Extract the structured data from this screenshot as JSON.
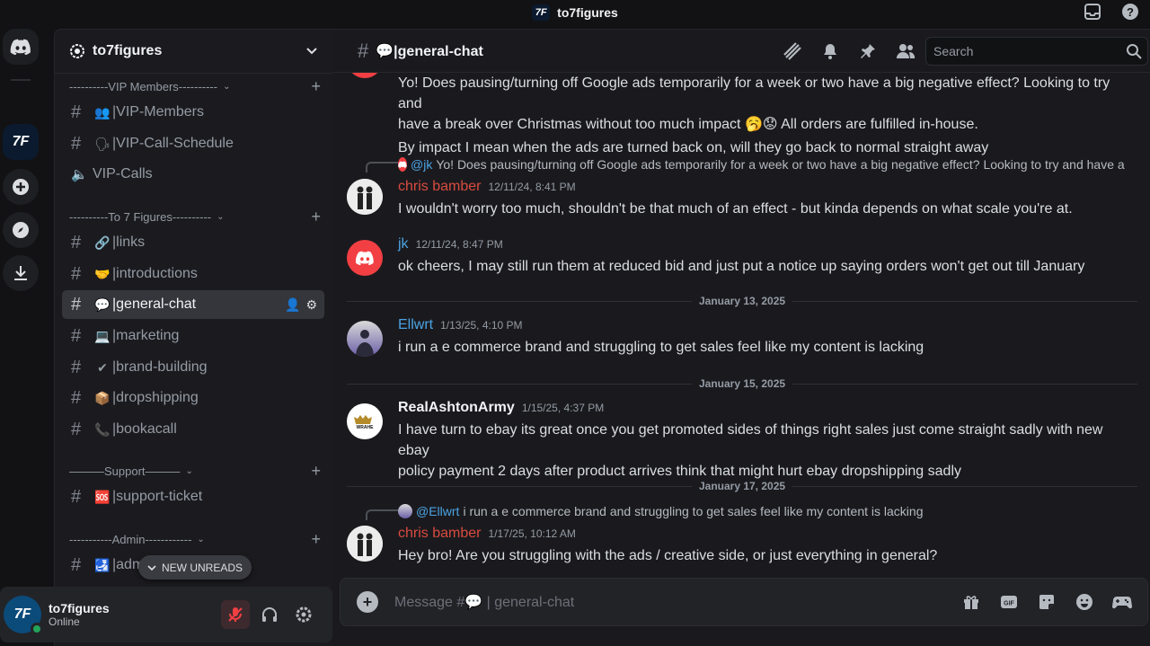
{
  "app": {
    "title": "to7figures",
    "logo_text": "7F"
  },
  "server": {
    "name": "to7figures"
  },
  "categories": [
    {
      "label": "----------VIP Members----------"
    },
    {
      "label": "----------To 7 Figures----------"
    },
    {
      "label": "———Support———"
    },
    {
      "label": "-----------Admin------------"
    }
  ],
  "channels": [
    {
      "emoji": "👥",
      "label": "|VIP-Members"
    },
    {
      "emoji": "🗣",
      "label": "|VIP-Call-Schedule"
    },
    {
      "emoji": "",
      "label": "VIP-Calls"
    },
    {
      "emoji": "🔗",
      "label": "|links"
    },
    {
      "emoji": "🤝",
      "label": "|introductions"
    },
    {
      "emoji": "💬",
      "label": "|general-chat"
    },
    {
      "emoji": "💻",
      "label": "|marketing"
    },
    {
      "emoji": "✔",
      "label": "|brand-building"
    },
    {
      "emoji": "📦",
      "label": "|dropshipping"
    },
    {
      "emoji": "📞",
      "label": "|bookacall"
    },
    {
      "emoji": "🆘",
      "label": "|support-ticket"
    },
    {
      "emoji": "🛃",
      "label": "|adm"
    }
  ],
  "new_unreads": "NEW UNREADS",
  "user": {
    "name": "to7figures",
    "status": "Online"
  },
  "header": {
    "channel": "💬|general-chat",
    "search_placeholder": "Search"
  },
  "messages": {
    "m1_line1": "Yo! Does pausing/turning off Google ads temporarily for a week or two have a big negative effect? Looking to try and",
    "m1_line2": "have a break over Christmas without too much impact",
    "m1_line2b": "All orders are fulfilled in-house.",
    "m1_line3": "By impact I mean when the ads are turned back on, will they go back to normal straight away",
    "r1_who": "@jk",
    "r1_text": "Yo! Does pausing/turning off Google ads temporarily for a week or two have a big negative effect? Looking to try and have a ...",
    "m2_author": "chris bamber",
    "m2_ts": "12/11/24, 8:41 PM",
    "m2_text": "I wouldn't worry too much, shouldn't be that much of an effect - but kinda depends on what scale you're at.",
    "m3_author": "jk",
    "m3_ts": "12/11/24, 8:47 PM",
    "m3_text": "ok cheers, I may still run them at reduced bid and just put a notice up saying orders won't get out till January",
    "d1": "January 13, 2025",
    "m4_author": "Ellwrt",
    "m4_ts": "1/13/25, 4:10 PM",
    "m4_text": "i run a e commerce brand and struggling to get sales feel like my content is lacking",
    "d2": "January 15, 2025",
    "m5_author": "RealAshtonArmy",
    "m5_ts": "1/15/25, 4:37 PM",
    "m5_text1": "I have turn to ebay  its great once you get promoted sides of things right sales just come straight sadly with new ebay",
    "m5_text2": "policy payment 2 days after product arrives think that might hurt ebay dropshipping sadly",
    "m5_avatar_text": "WRAHE",
    "d3": "January 17, 2025",
    "r2_who": "@Ellwrt",
    "r2_text": "i run a e commerce brand and struggling to get sales feel like my content is lacking",
    "m6_author": "chris bamber",
    "m6_ts": "1/17/25, 10:12 AM",
    "m6_text": "Hey bro! Are you struggling with the ads / creative side, or just everything in general?"
  },
  "composer": {
    "placeholder": "Message #💬 | general-chat",
    "gif_label": "GIF"
  }
}
